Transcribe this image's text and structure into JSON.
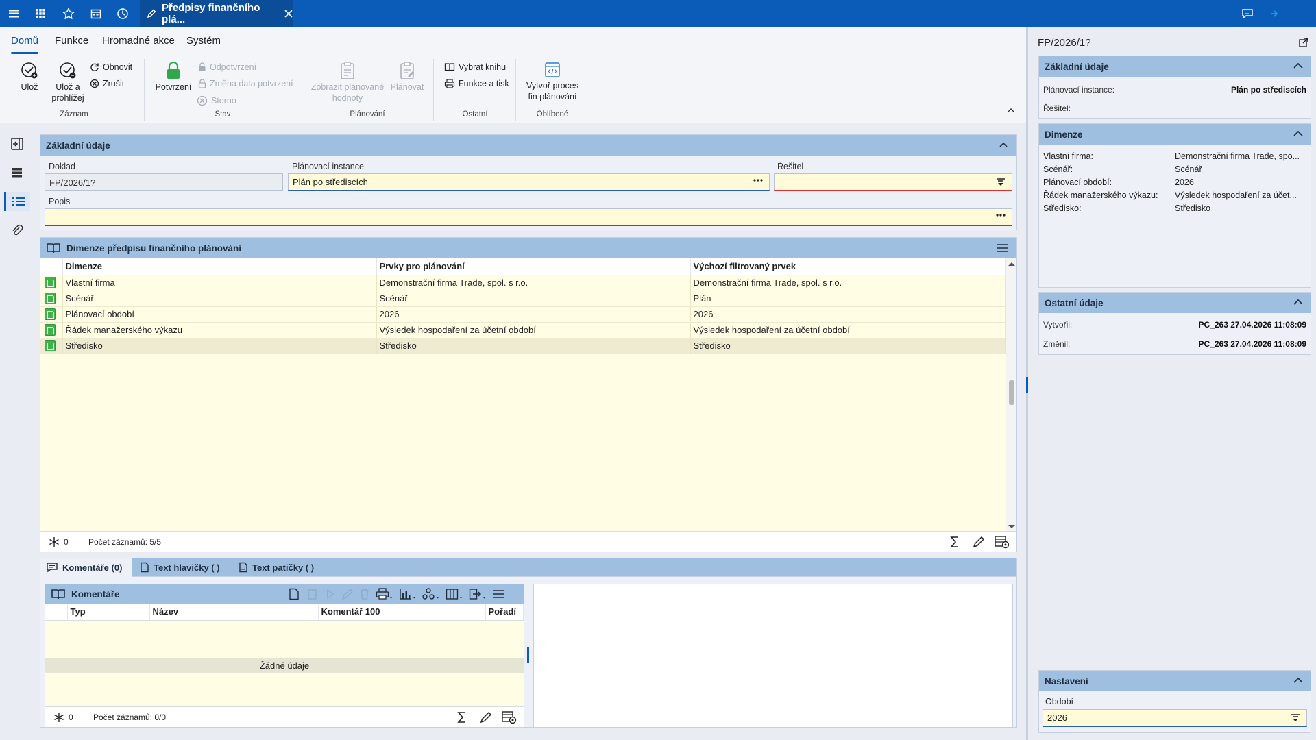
{
  "topbar": {
    "active_tab_title": "Předpisy finančního plá...",
    "icons": [
      "hamburger-icon",
      "apps-grid-icon",
      "star-icon",
      "calendar-icon",
      "history-icon",
      "chat-icon",
      "arrow-right-icon"
    ]
  },
  "menu_tabs": [
    "Domů",
    "Funkce",
    "Hromadné akce",
    "Systém"
  ],
  "ribbon": {
    "save": "Ulož",
    "save_browse": "Ulož a prohlížej",
    "refresh": "Obnovit",
    "cancel": "Zrušit",
    "group_record": "Záznam",
    "confirm": "Potvrzení",
    "unconfirm": "Odpotvrzení",
    "change_confirm_date": "Změna data potvrzení",
    "storno": "Storno",
    "group_state": "Stav",
    "show_planned": "Zobrazit plánované hodnoty",
    "plan": "Plánovat",
    "group_planning": "Plánování",
    "choose_book": "Vybrat knihu",
    "functions_print": "Funkce a tisk",
    "group_other": "Ostatní",
    "create_process": "Vytvoř proces fin plánování",
    "group_favorites": "Oblíbené"
  },
  "basic": {
    "title": "Základní údaje",
    "doklad_label": "Doklad",
    "doklad_value": "FP/2026/1?",
    "instance_label": "Plánovací instance",
    "instance_value": "Plán po střediscích",
    "resitel_label": "Řešitel",
    "resitel_value": "",
    "popis_label": "Popis",
    "popis_value": ""
  },
  "dims": {
    "title": "Dimenze předpisu finančního plánování",
    "columns": [
      "Dimenze",
      "Prvky pro plánování",
      "Výchozí filtrovaný prvek"
    ],
    "rows": [
      [
        "Vlastní firma",
        "Demonstrační firma Trade, spol. s r.o.",
        "Demonstrační firma Trade, spol. s r.o."
      ],
      [
        "Scénář",
        "Scénář",
        "Plán"
      ],
      [
        "Plánovací období",
        "2026",
        "2026"
      ],
      [
        "Řádek manažerského výkazu",
        "Výsledek hospodaření za účetní období",
        "Výsledek hospodaření za účetní období"
      ],
      [
        "Středisko",
        "Středisko",
        "Středisko"
      ]
    ],
    "footer_count": "0",
    "footer_records": "Počet záznamů: 5/5"
  },
  "bottom_tabs": [
    "Komentáře (0)",
    "Text hlavičky ( )",
    "Text patičky ( )"
  ],
  "comments": {
    "title": "Komentáře",
    "columns": [
      "Typ",
      "Název",
      "Komentář 100",
      "Pořadí"
    ],
    "empty": "Žádné údaje",
    "footer_count": "0",
    "footer_records": "Počet záznamů: 0/0"
  },
  "right": {
    "doc_id": "FP/2026/1?",
    "basic": {
      "title": "Základní údaje",
      "instance_label": "Plánovací instance:",
      "instance_value": "Plán po střediscích",
      "resitel_label": "Řešitel:"
    },
    "dims": {
      "title": "Dimenze",
      "items": [
        {
          "k": "Vlastní firma:",
          "v": "Demonstrační firma Trade, spo..."
        },
        {
          "k": "Scénář:",
          "v": "Scénář"
        },
        {
          "k": "Plánovací období:",
          "v": "2026"
        },
        {
          "k": "Řádek manažerského výkazu:",
          "v": "Výsledek hospodaření za účet..."
        },
        {
          "k": "Středisko:",
          "v": "Středisko"
        }
      ]
    },
    "other": {
      "title": "Ostatní údaje",
      "created_label": "Vytvořil:",
      "created_value": "PC_263 27.04.2026 11:08:09",
      "changed_label": "Změnil:",
      "changed_value": "PC_263 27.04.2026 11:08:09"
    },
    "settings": {
      "title": "Nastavení",
      "period_label": "Období",
      "period_value": "2026"
    }
  },
  "colors": {
    "brand": "#0a5cb8",
    "panel_header": "#9fbfe0",
    "row_bg": "#fffde3",
    "input_bg": "#fffbd9",
    "required_red": "#d33"
  }
}
